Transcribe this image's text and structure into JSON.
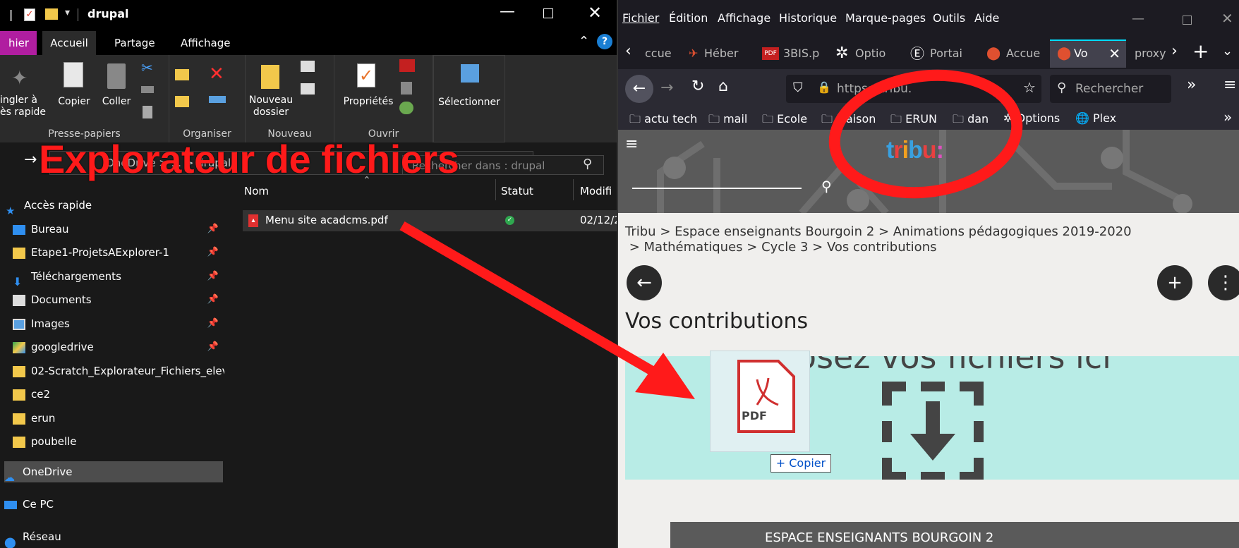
{
  "explorer": {
    "window_title": "drupal",
    "menu_tabs": [
      "hier",
      "Accueil",
      "Partage",
      "Affichage"
    ],
    "ribbon": {
      "groups": [
        {
          "label": "Presse-papiers",
          "buttons": [
            "ingler à\nès rapide",
            "Copier",
            "Coller"
          ]
        },
        {
          "label": "Organiser",
          "buttons": []
        },
        {
          "label": "Nouveau",
          "buttons": [
            "Nouveau\ndossier"
          ]
        },
        {
          "label": "Ouvrir",
          "buttons": [
            "Propriétés"
          ]
        },
        {
          "label": "",
          "buttons": [
            "Sélectionner"
          ]
        }
      ]
    },
    "address": {
      "path": "OneDrive > ... > drupal",
      "search_placeholder": "Rechercher dans : drupal"
    },
    "nav": {
      "items": [
        {
          "label": "Accès rapide",
          "icon": "star-icon",
          "pinned": false
        },
        {
          "label": "Bureau",
          "icon": "desktop-icon",
          "pinned": true
        },
        {
          "label": "Etape1-ProjetsAExplorer-1",
          "icon": "folder-icon",
          "pinned": true
        },
        {
          "label": "Téléchargements",
          "icon": "download-icon",
          "pinned": true
        },
        {
          "label": "Documents",
          "icon": "document-icon",
          "pinned": true
        },
        {
          "label": "Images",
          "icon": "image-icon",
          "pinned": true
        },
        {
          "label": "googledrive",
          "icon": "drive-icon",
          "pinned": true
        },
        {
          "label": "02-Scratch_Explorateur_Fichiers_eleve",
          "icon": "folder-icon",
          "pinned": false
        },
        {
          "label": "ce2",
          "icon": "folder-icon",
          "pinned": false
        },
        {
          "label": "erun",
          "icon": "folder-icon",
          "pinned": false
        },
        {
          "label": "poubelle",
          "icon": "folder-icon",
          "pinned": false
        },
        {
          "label": "OneDrive",
          "icon": "cloud-icon",
          "pinned": false
        },
        {
          "label": "Ce PC",
          "icon": "computer-icon",
          "pinned": false
        },
        {
          "label": "Réseau",
          "icon": "network-icon",
          "pinned": false
        }
      ]
    },
    "columns": [
      "Nom",
      "Statut",
      "Modifi"
    ],
    "files": [
      {
        "name": "Menu site acadcms.pdf",
        "status": "synced",
        "modified": "02/12/2"
      }
    ]
  },
  "annotation": {
    "label": "Explorateur de fichiers",
    "color": "#ff1a1a"
  },
  "firefox": {
    "menu": [
      "Fichier",
      "Édition",
      "Affichage",
      "Historique",
      "Marque-pages",
      "Outils",
      "Aide"
    ],
    "tabs": [
      "ccue",
      "Héber",
      "3BIS.p",
      "Optio",
      "Portai",
      "Accue",
      "Vo",
      "proxy"
    ],
    "url_text": "https://tribu.",
    "search_placeholder": "Rechercher",
    "bookmarks": [
      "actu tech",
      "mail",
      "Ecole",
      "Maison",
      "ERUN",
      "dan",
      "Options",
      "Plex"
    ],
    "breadcrumb_line1": [
      "Tribu",
      "Espace enseignants Bourgoin 2",
      "Animations pédagogiques 2019-2020"
    ],
    "breadcrumb_line2": [
      "Mathématiques",
      "Cycle 3",
      "Vos contributions"
    ],
    "page_title": "Vos contributions",
    "drop_text": "Déposez vos fichiers ici",
    "drag_file_label": "PDF",
    "copy_tooltip": "+ Copier",
    "bottom_text": "ESPACE ENSEIGNANTS BOURGOIN 2"
  }
}
